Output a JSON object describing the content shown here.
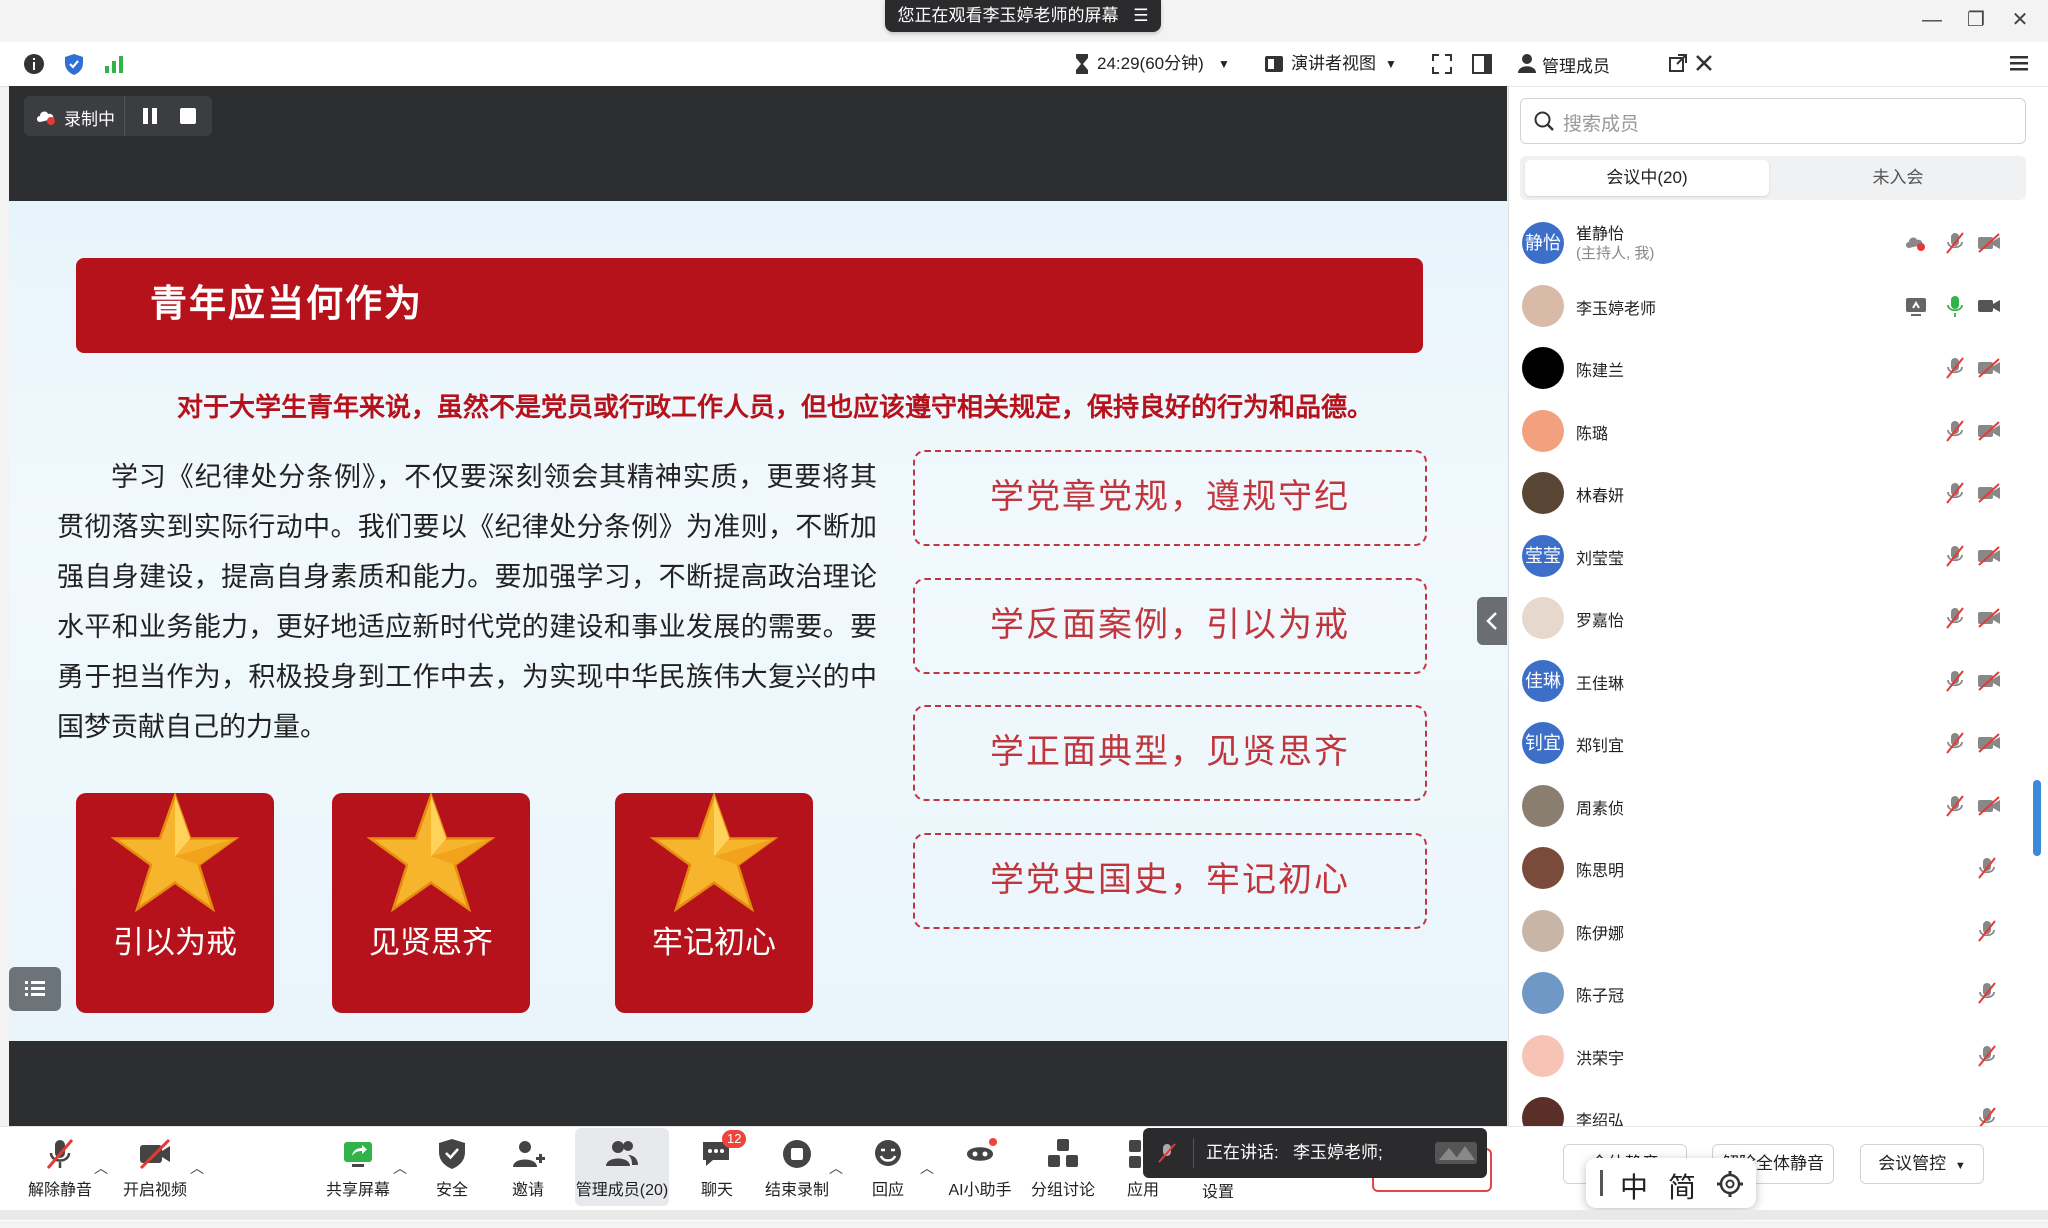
{
  "window": {
    "share_banner": "您正在观看李玉婷老师的屏幕",
    "controls": [
      "minimize",
      "restore",
      "close"
    ]
  },
  "topbar": {
    "timer": "24:29(60分钟)",
    "view_mode": "演讲者视图",
    "panel_title": "管理成员"
  },
  "recording": {
    "label": "录制中"
  },
  "slide": {
    "header": "青年应当何作为",
    "subtitle": "对于大学生青年来说，虽然不是党员或行政工作人员，但也应该遵守相关规定，保持良好的行为和品德。",
    "paragraph": "学习《纪律处分条例》，不仅要深刻领会其精神实质，更要将其贯彻落实到实际行动中。我们要以《纪律处分条例》为准则，不断加强自身建设，提高自身素质和能力。要加强学习，不断提高政治理论水平和业务能力，更好地适应新时代党的建设和事业发展的需要。要勇于担当作为，积极投身到工作中去，为实现中华民族伟大复兴的中国梦贡献自己的力量。",
    "boxes": [
      "学党章党规，遵规守纪",
      "学反面案例，引以为戒",
      "学正面典型，见贤思齐",
      "学党史国史，牢记初心"
    ],
    "cards": [
      "引以为戒",
      "见贤思齐",
      "牢记初心"
    ]
  },
  "toolbar": {
    "unmute": "解除静音",
    "video": "开启视频",
    "share": "共享屏幕",
    "security": "安全",
    "invite": "邀请",
    "members": "管理成员(20)",
    "chat": "聊天",
    "chat_badge": "12",
    "end_record": "结束录制",
    "react": "回应",
    "ai": "AI小助手",
    "breakout": "分组讨论",
    "apps": "应用",
    "settings": "设置"
  },
  "speaking": {
    "label": "正在讲话:",
    "name": "李玉婷老师;"
  },
  "panel": {
    "search_placeholder": "搜索成员",
    "tab_in_meeting": "会议中(20)",
    "tab_not_joined": "未入会",
    "members": [
      {
        "name": "崔静怡",
        "role": "(主持人, 我)",
        "avatar": "静怡",
        "avatar_color": "#3d6fc9"
      },
      {
        "name": "李玉婷老师",
        "role": "",
        "avatar": "",
        "avatar_color": "#d9b9a8"
      },
      {
        "name": "陈建兰",
        "role": "",
        "avatar": "",
        "avatar_color": "#000000"
      },
      {
        "name": "陈璐",
        "role": "",
        "avatar": "",
        "avatar_color": "#f3a07e"
      },
      {
        "name": "林春妍",
        "role": "",
        "avatar": "",
        "avatar_color": "#5a4634"
      },
      {
        "name": "刘莹莹",
        "role": "",
        "avatar": "莹莹",
        "avatar_color": "#3d6fc9"
      },
      {
        "name": "罗嘉怡",
        "role": "",
        "avatar": "",
        "avatar_color": "#e6d8cc"
      },
      {
        "name": "王佳琳",
        "role": "",
        "avatar": "佳琳",
        "avatar_color": "#3d6fc9"
      },
      {
        "name": "郑钊宜",
        "role": "",
        "avatar": "钊宜",
        "avatar_color": "#3d6fc9"
      },
      {
        "name": "周素侦",
        "role": "",
        "avatar": "",
        "avatar_color": "#8a7e70"
      },
      {
        "name": "陈思明",
        "role": "",
        "avatar": "",
        "avatar_color": "#7a4a3a"
      },
      {
        "name": "陈伊娜",
        "role": "",
        "avatar": "",
        "avatar_color": "#c9b5a6"
      },
      {
        "name": "陈子冠",
        "role": "",
        "avatar": "",
        "avatar_color": "#6f98c6"
      },
      {
        "name": "洪荣宇",
        "role": "",
        "avatar": "",
        "avatar_color": "#f7c3b4"
      },
      {
        "name": "李绍弘",
        "role": "",
        "avatar": "",
        "avatar_color": "#5a2f2a"
      }
    ],
    "footer_mute_all": "全体静音",
    "footer_unmute_all": "解除全体静音",
    "footer_control": "会议管控"
  },
  "ime": {
    "mode": "中",
    "script": "简"
  },
  "colors": {
    "slide_red": "#b5121b",
    "accent_blue": "#3d6fc9",
    "stage_dark": "#2d2e30"
  }
}
